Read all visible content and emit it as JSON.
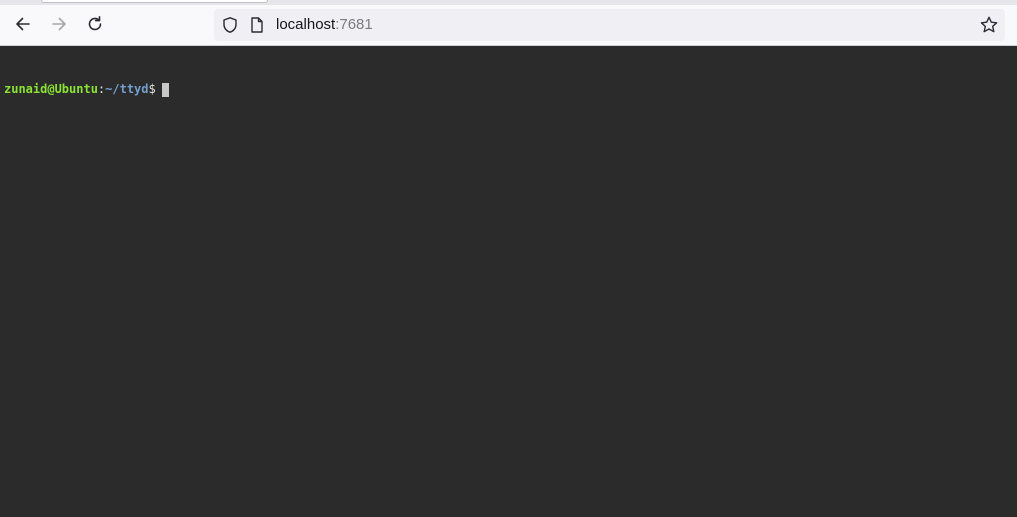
{
  "browser": {
    "url_host": "localhost",
    "url_port": ":7681",
    "icons": {
      "back": "arrow-left-icon",
      "forward": "arrow-right-icon",
      "reload": "reload-icon",
      "shield": "shield-icon",
      "page": "page-icon",
      "bookmark": "star-icon"
    }
  },
  "terminal": {
    "prompt_user_host": "zunaid@Ubuntu",
    "prompt_colon": ":",
    "prompt_path": "~/ttyd",
    "prompt_symbol": "$",
    "colors": {
      "background": "#2b2b2b",
      "user_host": "#8ae234",
      "path": "#729fcf",
      "cursor": "#c8c8c8"
    }
  }
}
